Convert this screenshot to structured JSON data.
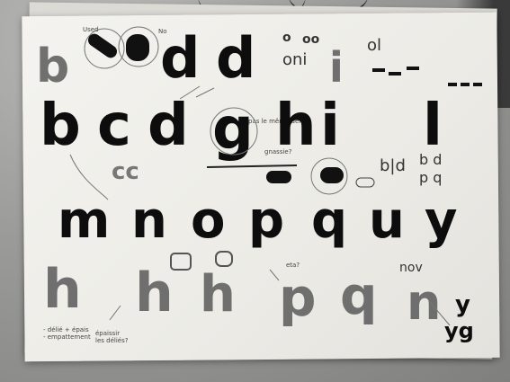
{
  "photo": {
    "row1": {
      "glyphs": [
        "b",
        "d",
        "d"
      ],
      "notes": [
        "Used",
        "No"
      ],
      "pills": [
        "o",
        "oo",
        "oni",
        "ol",
        "i"
      ]
    },
    "row2": {
      "glyphs": [
        "b",
        "c",
        "d",
        "g",
        "h",
        "i",
        "l"
      ],
      "notes": [
        "pas le même délié",
        "gnassie?"
      ]
    },
    "row3": {
      "glyphs": [
        "m",
        "n",
        "o",
        "p",
        "q",
        "u",
        "y"
      ],
      "small": [
        "cc",
        "b|d",
        "b d",
        "p q"
      ]
    },
    "row4": {
      "glyphs": [
        "h",
        "h",
        "h",
        "p",
        "q",
        "n"
      ],
      "notes": [
        "nov",
        "eta?",
        "- délié + épais\n- empattement",
        "épaissir\nles déliés?"
      ],
      "bottom_right": [
        "y",
        "yg"
      ]
    }
  },
  "colors": {
    "ink": "#0d0d0d",
    "pencil": "#5a5a5a",
    "paper": "#f0efea"
  }
}
